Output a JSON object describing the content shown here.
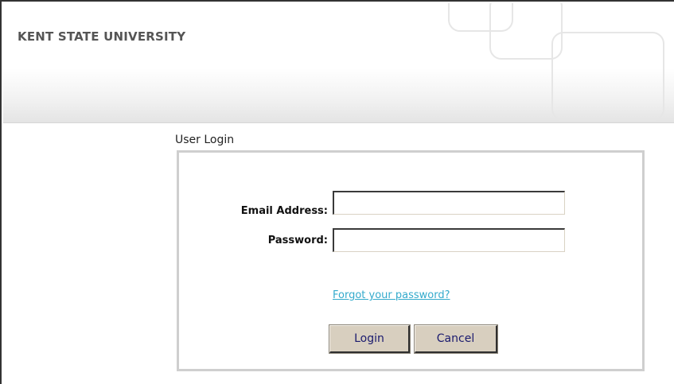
{
  "header": {
    "brand": "KENT STATE UNIVERSITY"
  },
  "login": {
    "section_title": "User Login",
    "email_label": "Email Address:",
    "email_value": "",
    "password_label": "Password:",
    "password_value": "",
    "forgot_link": "Forgot your password?",
    "login_button": "Login",
    "cancel_button": "Cancel"
  },
  "colors": {
    "brand_text": "#555555",
    "link": "#33aacc",
    "button_face": "#d8cfbf",
    "button_text": "#1a1a6e",
    "box_border": "#cfcfcf"
  }
}
